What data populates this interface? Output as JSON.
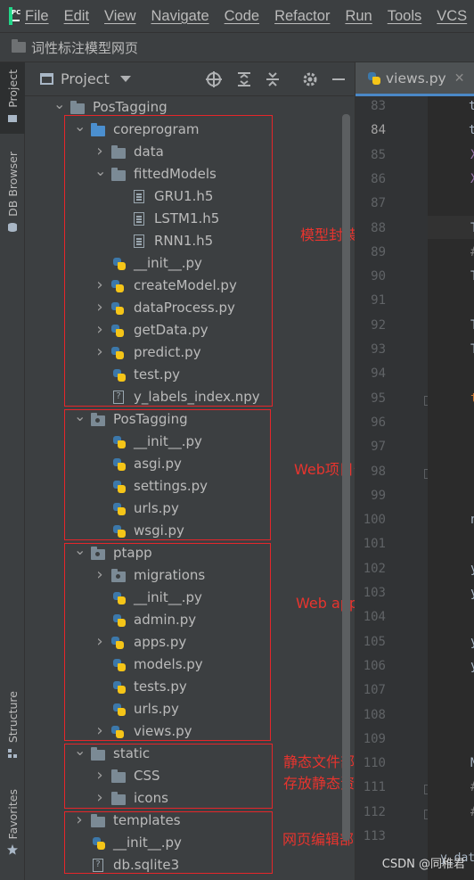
{
  "menubar": {
    "items": [
      "File",
      "Edit",
      "View",
      "Navigate",
      "Code",
      "Refactor",
      "Run",
      "Tools",
      "VCS"
    ]
  },
  "breadcrumb": {
    "label": "词性标注模型网页"
  },
  "stripe": {
    "project_label": "Project",
    "db_label": "DB Browser",
    "structure_label": "Structure",
    "favorites_label": "Favorites"
  },
  "project_panel": {
    "title": "Project"
  },
  "tree": [
    {
      "label": "PosTagging",
      "icon": "folder",
      "depth": 0,
      "arrow": "down"
    },
    {
      "label": "coreprogram",
      "icon": "folder-blue",
      "depth": 1,
      "arrow": "down"
    },
    {
      "label": "data",
      "icon": "folder",
      "depth": 2,
      "arrow": "right"
    },
    {
      "label": "fittedModels",
      "icon": "folder",
      "depth": 2,
      "arrow": "down"
    },
    {
      "label": "GRU1.h5",
      "icon": "doc",
      "depth": 3,
      "arrow": ""
    },
    {
      "label": "LSTM1.h5",
      "icon": "doc",
      "depth": 3,
      "arrow": ""
    },
    {
      "label": "RNN1.h5",
      "icon": "doc",
      "depth": 3,
      "arrow": ""
    },
    {
      "label": "__init__.py",
      "icon": "py",
      "depth": 2,
      "arrow": ""
    },
    {
      "label": "createModel.py",
      "icon": "py",
      "depth": 2,
      "arrow": "right"
    },
    {
      "label": "dataProcess.py",
      "icon": "py",
      "depth": 2,
      "arrow": "right"
    },
    {
      "label": "getData.py",
      "icon": "py",
      "depth": 2,
      "arrow": "right"
    },
    {
      "label": "predict.py",
      "icon": "py",
      "depth": 2,
      "arrow": "right"
    },
    {
      "label": "test.py",
      "icon": "py",
      "depth": 2,
      "arrow": ""
    },
    {
      "label": "y_labels_index.npy",
      "icon": "unknown",
      "depth": 2,
      "arrow": ""
    },
    {
      "label": "PosTagging",
      "icon": "folder-pkg",
      "depth": 1,
      "arrow": "down"
    },
    {
      "label": "__init__.py",
      "icon": "py",
      "depth": 2,
      "arrow": ""
    },
    {
      "label": "asgi.py",
      "icon": "py",
      "depth": 2,
      "arrow": ""
    },
    {
      "label": "settings.py",
      "icon": "py",
      "depth": 2,
      "arrow": ""
    },
    {
      "label": "urls.py",
      "icon": "py",
      "depth": 2,
      "arrow": ""
    },
    {
      "label": "wsgi.py",
      "icon": "py",
      "depth": 2,
      "arrow": ""
    },
    {
      "label": "ptapp",
      "icon": "folder-pkg",
      "depth": 1,
      "arrow": "down"
    },
    {
      "label": "migrations",
      "icon": "folder-pkg",
      "depth": 2,
      "arrow": "right"
    },
    {
      "label": "__init__.py",
      "icon": "py",
      "depth": 2,
      "arrow": ""
    },
    {
      "label": "admin.py",
      "icon": "py",
      "depth": 2,
      "arrow": ""
    },
    {
      "label": "apps.py",
      "icon": "py",
      "depth": 2,
      "arrow": "right"
    },
    {
      "label": "models.py",
      "icon": "py",
      "depth": 2,
      "arrow": ""
    },
    {
      "label": "tests.py",
      "icon": "py",
      "depth": 2,
      "arrow": ""
    },
    {
      "label": "urls.py",
      "icon": "py",
      "depth": 2,
      "arrow": ""
    },
    {
      "label": "views.py",
      "icon": "py",
      "depth": 2,
      "arrow": "right"
    },
    {
      "label": "static",
      "icon": "folder",
      "depth": 1,
      "arrow": "down"
    },
    {
      "label": "CSS",
      "icon": "folder",
      "depth": 2,
      "arrow": "right"
    },
    {
      "label": "icons",
      "icon": "folder",
      "depth": 2,
      "arrow": "right"
    },
    {
      "label": "templates",
      "icon": "folder",
      "depth": 1,
      "arrow": "right"
    },
    {
      "label": "__init__.py",
      "icon": "py",
      "depth": 1,
      "arrow": ""
    },
    {
      "label": "db.sqlite3",
      "icon": "unknown",
      "depth": 1,
      "arrow": ""
    }
  ],
  "annotations": {
    "model": "模型封装部分",
    "web_project": "Web项目部分",
    "web_app": "Web app部分",
    "static_line1": "静态文件部分",
    "static_line2": "存放静态资源文件",
    "templates": "网页编辑部分"
  },
  "annotation_color": "#e5262a",
  "editor": {
    "tab_label": "views.py",
    "current_line": "84",
    "line_numbers": [
      "83",
      "84",
      "85",
      "86",
      "87",
      "88",
      "89",
      "90",
      "91",
      "92",
      "93",
      "94",
      "95",
      "96",
      "97",
      "98",
      "99",
      "100",
      "101",
      "102",
      "103",
      "104",
      "105",
      "106",
      "107",
      "108",
      "109",
      "110",
      "111",
      "112",
      "113"
    ],
    "snippets": [
      "t",
      "t",
      "X",
      "X",
      "",
      "T",
      "#",
      "T",
      "",
      "T",
      "T",
      "",
      "t",
      "",
      "",
      "",
      "",
      "n",
      "",
      "y",
      "y",
      "",
      "y",
      "y",
      "",
      "",
      "",
      "M",
      "#",
      "#",
      ""
    ],
    "bottom_text": "y_dat"
  },
  "watermark": "CSDN @同稚君"
}
